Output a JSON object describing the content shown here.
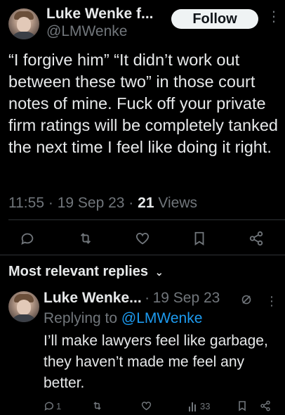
{
  "tweet": {
    "author_name": "Luke Wenke f...",
    "author_handle": "@LMWenke",
    "follow_label": "Follow",
    "text": "“I forgive him” “It didn’t work out between these two” in those court notes of mine.  Fuck off your private firm ratings will be completely tanked the next time I feel like doing it right.",
    "time": "11:55",
    "sep1": "·",
    "date": "19 Sep 23",
    "sep2": "·",
    "views_count": "21",
    "views_label": "Views"
  },
  "actions": {
    "reply_icon": "comment-icon",
    "retweet_icon": "retweet-icon",
    "like_icon": "heart-icon",
    "bookmark_icon": "bookmark-icon",
    "share_icon": "share-icon"
  },
  "replies_section": {
    "title": "Most relevant replies",
    "chevron_icon": "chevron-down-icon"
  },
  "reply": {
    "author_name": "Luke Wenke...",
    "sep": "·",
    "date": "19 Sep 23",
    "replying_prefix": "Replying to",
    "replying_handle": "@LMWenke",
    "text": "I’ll make lawyers feel like garbage, they haven’t made me feel any better.",
    "reply_count": "1",
    "views_count": "33"
  },
  "colors": {
    "background": "#000000",
    "text": "#e7e9ea",
    "muted": "#71767b",
    "link": "#1d9bf0",
    "divider": "#2f3336",
    "follow_bg": "#eff3f4"
  }
}
